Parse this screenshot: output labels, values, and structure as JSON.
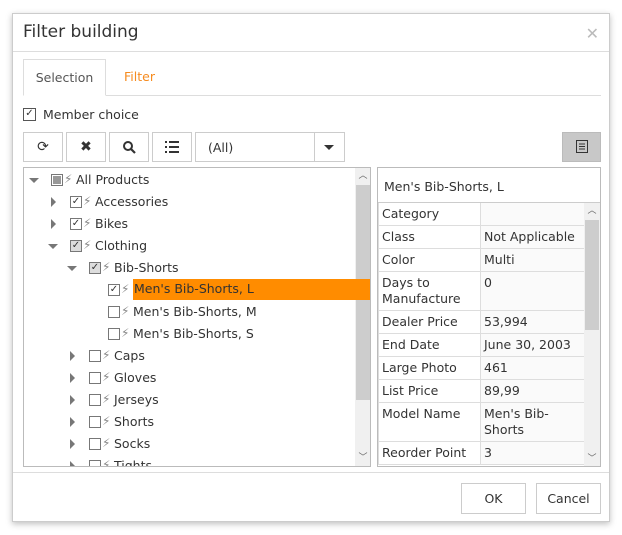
{
  "dialog": {
    "title": "Filter building",
    "close_icon": "close-icon"
  },
  "tabs": [
    {
      "label": "Selection",
      "active": true
    },
    {
      "label": "Filter",
      "active": false
    }
  ],
  "member_choice": {
    "label": "Member choice",
    "checked": true
  },
  "toolbar": {
    "buttons": [
      "refresh-icon",
      "clear-icon",
      "search-icon",
      "list-icon"
    ],
    "dropdown_value": "(All)",
    "view_button": "details-view-icon"
  },
  "colors": {
    "accent": "#f68b1f",
    "highlight": "#ff8c00"
  },
  "tree": [
    {
      "label": "All Products",
      "level": 0,
      "expander": "down",
      "check": "partial"
    },
    {
      "label": "Accessories",
      "level": 1,
      "expander": "right",
      "check": "checked"
    },
    {
      "label": "Bikes",
      "level": 1,
      "expander": "right",
      "check": "checked"
    },
    {
      "label": "Clothing",
      "level": 1,
      "expander": "down",
      "check": "partial-checked"
    },
    {
      "label": "Bib-Shorts",
      "level": 2,
      "expander": "down",
      "check": "partial-checked"
    },
    {
      "label": "Men's Bib-Shorts, L",
      "level": 3,
      "expander": "none",
      "check": "checked",
      "selected": true
    },
    {
      "label": "Men's Bib-Shorts, M",
      "level": 3,
      "expander": "none",
      "check": "unchecked"
    },
    {
      "label": "Men's Bib-Shorts, S",
      "level": 3,
      "expander": "none",
      "check": "unchecked"
    },
    {
      "label": "Caps",
      "level": 2,
      "expander": "right",
      "check": "unchecked"
    },
    {
      "label": "Gloves",
      "level": 2,
      "expander": "right",
      "check": "unchecked"
    },
    {
      "label": "Jerseys",
      "level": 2,
      "expander": "right",
      "check": "unchecked"
    },
    {
      "label": "Shorts",
      "level": 2,
      "expander": "right",
      "check": "unchecked"
    },
    {
      "label": "Socks",
      "level": 2,
      "expander": "right",
      "check": "unchecked"
    },
    {
      "label": "Tights",
      "level": 2,
      "expander": "right",
      "check": "unchecked"
    }
  ],
  "properties": {
    "title": "Men's Bib-Shorts, L",
    "rows": [
      {
        "key": "Category",
        "value": ""
      },
      {
        "key": "Class",
        "value": "Not Applicable"
      },
      {
        "key": "Color",
        "value": "Multi"
      },
      {
        "key": "Days to Manufacture",
        "value": "0"
      },
      {
        "key": "Dealer Price",
        "value": "53,994"
      },
      {
        "key": "End Date",
        "value": "June 30, 2003"
      },
      {
        "key": "Large Photo",
        "value": "461"
      },
      {
        "key": "List Price",
        "value": "89,99"
      },
      {
        "key": "Model Name",
        "value": "Men's Bib-Shorts"
      },
      {
        "key": "Reorder Point",
        "value": "3"
      }
    ]
  },
  "footer": {
    "ok": "OK",
    "cancel": "Cancel"
  }
}
